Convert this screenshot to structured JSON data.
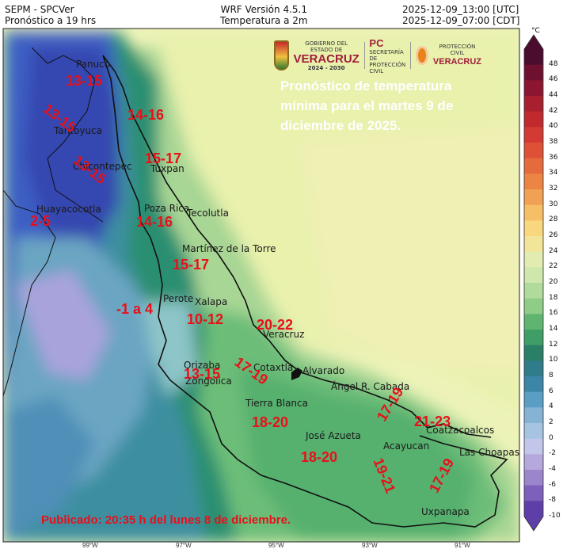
{
  "header": {
    "left_line1": "SEPM - SPCVer",
    "left_line2": "Pronóstico a 19 hrs",
    "center_line1": "WRF Versión 4.5.1",
    "center_line2": "Temperatura a 2m",
    "right_line1": "2025-12-09_13:00 [UTC]",
    "right_line2": "2025-12-09_07:00 [CDT]"
  },
  "logos": {
    "gobierno_line1": "GOBIERNO DEL ESTADO DE",
    "gobierno_big": "VERACRUZ",
    "gobierno_years": "2024 - 2030",
    "pc": "PC",
    "pc_sub1": "SECRETARÍA DE",
    "pc_sub2": "PROTECCIÓN CIVIL",
    "pcivil_line1": "PROTECCIÓN CIVIL",
    "pcivil_big": "VERACRUZ"
  },
  "title": "Pronóstico de temperatura mínima para el martes 9 de diciembre de 2025.",
  "published": "Publicado: 20:35 h del lunes 8 de diciembre.",
  "colorbar": {
    "unit": "°C",
    "ticks": [
      48,
      46,
      44,
      42,
      40,
      38,
      36,
      34,
      32,
      30,
      28,
      26,
      24,
      22,
      20,
      18,
      16,
      14,
      12,
      10,
      8,
      6,
      4,
      2,
      0,
      -2,
      -4,
      -6,
      -8,
      -10
    ],
    "colors": [
      "#4a0d2e",
      "#6e1030",
      "#8c1632",
      "#a8202f",
      "#c02a2e",
      "#d23a33",
      "#de5137",
      "#e56a3c",
      "#ec8444",
      "#f1a154",
      "#f6bf66",
      "#f8d77e",
      "#f2e59a",
      "#e3ecb0",
      "#cfe6ac",
      "#b1db9c",
      "#8fcc88",
      "#5fb56f",
      "#3f9d66",
      "#2a7f67",
      "#2f7c8a",
      "#3b86a7",
      "#5a9ec3",
      "#84b3d4",
      "#a7c3e2",
      "#c2c7ea",
      "#b5a8dc",
      "#9b86cc",
      "#7d60bb",
      "#5e3fa8"
    ]
  },
  "temperature_labels": [
    {
      "text": "13-15"
    },
    {
      "text": "13-15"
    },
    {
      "text": "14-16"
    },
    {
      "text": "15-17"
    },
    {
      "text": "13-15"
    },
    {
      "text": "2-5"
    },
    {
      "text": "14-16"
    },
    {
      "text": "15-17"
    },
    {
      "text": "-1 a 4"
    },
    {
      "text": "10-12"
    },
    {
      "text": "20-22"
    },
    {
      "text": "17-19"
    },
    {
      "text": "13-15"
    },
    {
      "text": "18-20"
    },
    {
      "text": "17-19"
    },
    {
      "text": "21-23"
    },
    {
      "text": "18-20"
    },
    {
      "text": "19-21"
    },
    {
      "text": "17-19"
    }
  ],
  "cities": [
    {
      "text": "Panuco"
    },
    {
      "text": "Tantoyuca"
    },
    {
      "text": "Tuxpan"
    },
    {
      "text": "Chicontepec"
    },
    {
      "text": "Huayacocotla"
    },
    {
      "text": "Poza Rica"
    },
    {
      "text": "Tecolutla"
    },
    {
      "text": "Martínez de la Torre"
    },
    {
      "text": "Perote"
    },
    {
      "text": "Xalapa"
    },
    {
      "text": "Veracruz"
    },
    {
      "text": "Orizaba"
    },
    {
      "text": "Cotaxtla"
    },
    {
      "text": "Zongolica"
    },
    {
      "text": "Alvarado"
    },
    {
      "text": "Ángel R. Cabada"
    },
    {
      "text": "Tierra Blanca"
    },
    {
      "text": "José Azueta"
    },
    {
      "text": "Coatzacoalcos"
    },
    {
      "text": "Acayucan"
    },
    {
      "text": "Las Choapas"
    },
    {
      "text": "Uxpanapa"
    }
  ],
  "x_ticks": [
    "99°W",
    "97°W",
    "95°W",
    "93°W",
    "91°W"
  ]
}
